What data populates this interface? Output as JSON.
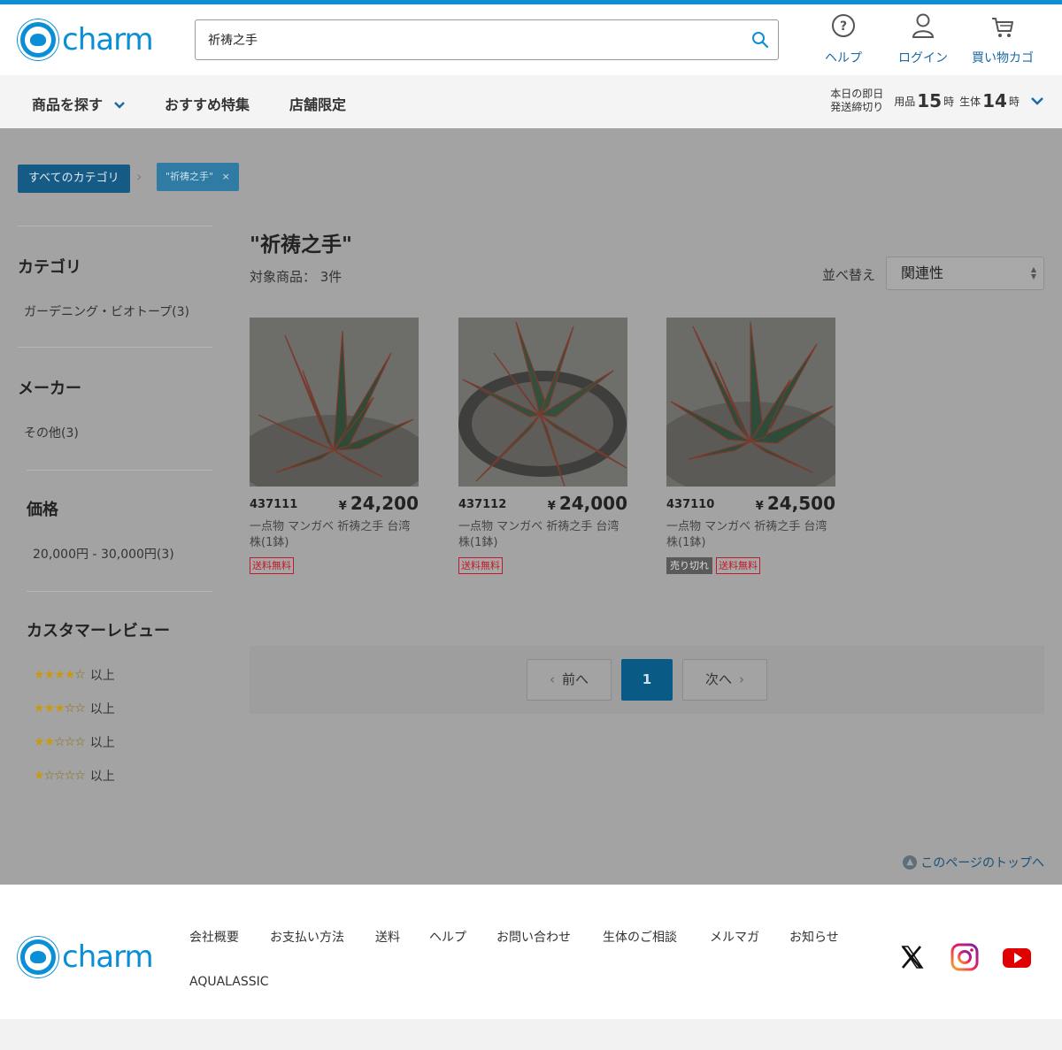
{
  "brand": {
    "name": "charm",
    "color": "#0a8fd6"
  },
  "search": {
    "value": "祈祷之手",
    "placeholder": ""
  },
  "header_nav": {
    "help": "ヘルプ",
    "login": "ログイン",
    "cart": "買い物カゴ"
  },
  "navbar": {
    "browse": "商品を探す",
    "featured": "おすすめ特集",
    "store_limited": "店舗限定",
    "cutoff_label_1": "本日の即日",
    "cutoff_label_2": "発送締切り",
    "goods_label": "用品",
    "goods_hour": "15",
    "live_label": "生体",
    "live_hour": "14",
    "hour_suffix": "時"
  },
  "breadcrumb": {
    "all": "すべてのカテゴリ",
    "query": "\"祈祷之手\"",
    "remove": "×"
  },
  "sidebar": {
    "category_title": "カテゴリ",
    "category_item": "ガーデニング・ビオトープ(3)",
    "maker_title": "メーカー",
    "maker_item": "その他(3)",
    "price_title": "価格",
    "price_item": "20,000円 - 30,000円(3)",
    "review_title": "カスタマーレビュー",
    "review_rows": [
      {
        "stars": 4,
        "label": "以上"
      },
      {
        "stars": 3,
        "label": "以上"
      },
      {
        "stars": 2,
        "label": "以上"
      },
      {
        "stars": 1,
        "label": "以上"
      }
    ]
  },
  "results": {
    "title": "\"祈祷之手\"",
    "count": "対象商品： 3件",
    "sort_label": "並べ替え",
    "sort_value": "関連性"
  },
  "products": [
    {
      "code": "437111",
      "currency": "¥",
      "price": "24,200",
      "name": "一点物 マンガベ 祈祷之手 台湾株(1鉢)",
      "sold_out": "",
      "free_shipping": "送料無料"
    },
    {
      "code": "437112",
      "currency": "¥",
      "price": "24,000",
      "name": "一点物 マンガベ 祈祷之手 台湾株(1鉢)",
      "sold_out": "",
      "free_shipping": "送料無料"
    },
    {
      "code": "437110",
      "currency": "¥",
      "price": "24,500",
      "name": "一点物 マンガベ 祈祷之手 台湾株(1鉢)",
      "sold_out": "売り切れ",
      "free_shipping": "送料無料"
    }
  ],
  "pager": {
    "prev": "前へ",
    "current": "1",
    "next": "次へ"
  },
  "to_top": "このページのトップへ",
  "footer": {
    "links": [
      "会社概要",
      "お支払い方法",
      "送料",
      "ヘルプ",
      "お問い合わせ",
      "生体のご相談",
      "メルマガ",
      "お知らせ",
      "AQUALASSIC"
    ],
    "social": [
      "x-icon",
      "instagram-icon",
      "youtube-icon"
    ]
  }
}
